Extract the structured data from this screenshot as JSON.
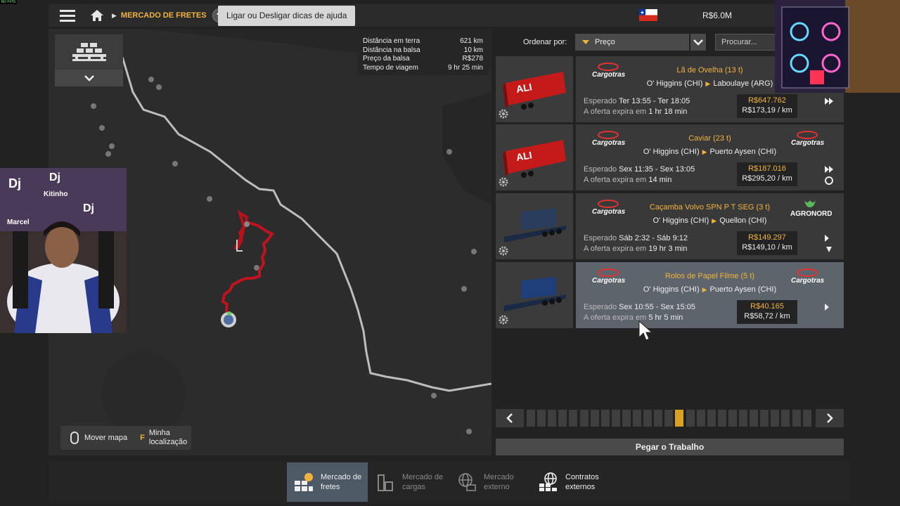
{
  "topbar": {
    "breadcrumb": "MERCADO DE FRETES",
    "help_symbol": "?",
    "tooltip": "Ligar ou Desligar dicas de ajuda",
    "money": "R$6.0M",
    "menu_icon": "hamburger-icon",
    "home_icon": "home-icon",
    "flag_icon": "chile-flag-icon"
  },
  "route_info": {
    "rows": [
      {
        "label": "Distância em terra",
        "value": "621 km"
      },
      {
        "label": "Distância na balsa",
        "value": "10 km"
      },
      {
        "label": "Preço da balsa",
        "value": "R$278"
      },
      {
        "label": "Tempo de viagem",
        "value": "9 hr 25 min"
      }
    ]
  },
  "map_controls": {
    "move_label": "Mover mapa",
    "loc_key": "F",
    "loc_label_1": "Minha",
    "loc_label_2": "localização"
  },
  "sort": {
    "label": "Ordenar por:",
    "value": "Preço",
    "search_placeholder": "Procurar..."
  },
  "jobs": [
    {
      "company_left": "Cargotras",
      "company_right": "",
      "cargo": "Lã de Ovelha (13 t)",
      "from": "O' Higgins (CHI)",
      "to": "Laboulaye (ARG)",
      "expected_label": "Esperado",
      "expected": "Ter 13:55 - Ter 18:05",
      "expire_label": "A oferta expira em",
      "expire": "1 hr 18 min",
      "price": "R$647.762",
      "per_km": "R$173,19 / km",
      "trailer_color": "#c41a1a",
      "trailer_brand": "ALI"
    },
    {
      "company_left": "Cargotras",
      "company_right": "Cargotras",
      "cargo": "Caviar (23 t)",
      "from": "O' Higgins (CHI)",
      "to": "Puerto Aysen (CHI)",
      "expected_label": "Esperado",
      "expected": "Sex 11:35 - Sex 13:05",
      "expire_label": "A oferta expira em",
      "expire": "14 min",
      "price": "R$187.016",
      "per_km": "R$295,20 / km",
      "trailer_color": "#c41a1a",
      "trailer_brand": "ALI"
    },
    {
      "company_left": "Cargotras",
      "company_right": "AGRONORD",
      "cargo": "Caçamba Volvo SPN P T SEG (3 t)",
      "from": "O' Higgins (CHI)",
      "to": "Quellon (CHI)",
      "expected_label": "Esperado",
      "expected": "Sáb 2:32 - Sáb 9:12",
      "expire_label": "A oferta expira em",
      "expire": "19 hr 3 min",
      "price": "R$149.297",
      "per_km": "R$149,10 / km",
      "trailer_color": "#2a3d5c",
      "trailer_brand": ""
    },
    {
      "company_left": "Cargotras",
      "company_right": "Cargotras",
      "cargo": "Rolos de Papel Filme (5 t)",
      "from": "O' Higgins (CHI)",
      "to": "Puerto Aysen (CHI)",
      "expected_label": "Esperado",
      "expected": "Sex 10:55 - Sex 15:05",
      "expire_label": "A oferta expira em",
      "expire": "5 hr 5 min",
      "price": "R$40.165",
      "per_km": "R$58,72 / km",
      "trailer_color": "#1e3f7a",
      "trailer_brand": ""
    }
  ],
  "pager": {
    "current_page": 15,
    "total_pages": 27
  },
  "take_job": "Pegar o Trabalho",
  "tabs": [
    {
      "line1": "Mercado de",
      "line2": "fretes",
      "icon": "freight-market-icon"
    },
    {
      "line1": "Mercado de",
      "line2": "cargas",
      "icon": "cargo-market-icon"
    },
    {
      "line1": "Mercado",
      "line2": "externo",
      "icon": "external-market-icon"
    },
    {
      "line1": "Contratos",
      "line2": "externos",
      "icon": "external-contracts-icon"
    }
  ],
  "overlays": {
    "fps": "60 FPS",
    "banner_text_1": "Dj",
    "banner_text_2": "Marcel",
    "banner_text_3": "Kitinho"
  },
  "colors": {
    "accent": "#f2b33d",
    "selected_job": "#5d646b",
    "active_tab": "#4d5a66",
    "route": "#c1121f"
  }
}
